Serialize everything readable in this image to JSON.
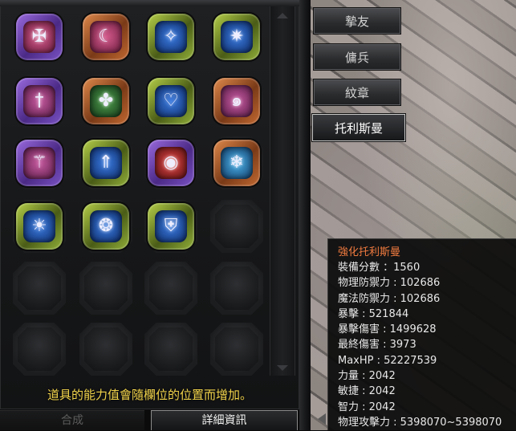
{
  "inventory": {
    "notice": "道具的能力值會隨欄位的位置而增加。",
    "rows": [
      [
        {
          "frame": "purple",
          "inner": "pink",
          "icon": "cross-shield-icon",
          "glyph": "✠"
        },
        {
          "frame": "orange",
          "inner": "pink",
          "icon": "crescent-gear-icon",
          "glyph": "☾"
        },
        {
          "frame": "green",
          "inner": "blue",
          "icon": "figure-star-icon",
          "glyph": "✧"
        },
        {
          "frame": "green",
          "inner": "blue",
          "icon": "snowflake-star-icon",
          "glyph": "✷"
        }
      ],
      [
        {
          "frame": "purple",
          "inner": "rose",
          "icon": "sword-emblem-icon",
          "glyph": "†"
        },
        {
          "frame": "orange",
          "inner": "green",
          "icon": "clover-cross-icon",
          "glyph": "✤"
        },
        {
          "frame": "green",
          "inner": "blue",
          "icon": "heart-icon",
          "glyph": "♡"
        },
        {
          "frame": "orange",
          "inner": "rose",
          "icon": "spiral-icon",
          "glyph": "๑"
        }
      ],
      [
        {
          "frame": "purple",
          "inner": "rose",
          "icon": "trident-icon",
          "glyph": "⚚"
        },
        {
          "frame": "green",
          "inner": "blue",
          "icon": "up-arrow-orbit-icon",
          "glyph": "⇑"
        },
        {
          "frame": "purple",
          "inner": "red",
          "icon": "map-pin-icon",
          "glyph": "◉"
        },
        {
          "frame": "orange",
          "inner": "cyan",
          "icon": "snowflake-icon",
          "glyph": "❄"
        }
      ],
      [
        {
          "frame": "green",
          "inner": "blue",
          "icon": "sun-bulb-icon",
          "glyph": "☀"
        },
        {
          "frame": "green",
          "inner": "blue",
          "icon": "wave-spiral-icon",
          "glyph": "❂"
        },
        {
          "frame": "green",
          "inner": "blue",
          "icon": "shield-emblem-icon",
          "glyph": "⛨"
        },
        null
      ],
      [
        null,
        null,
        null,
        null
      ],
      [
        null,
        null,
        null,
        null
      ]
    ]
  },
  "bottom_tabs": {
    "combine": "合成",
    "detail": "詳細資訊"
  },
  "side_menu": [
    {
      "label": "摯友",
      "active": false
    },
    {
      "label": "傭兵",
      "active": false
    },
    {
      "label": "紋章",
      "active": false
    },
    {
      "label": "托利斯曼",
      "active": true
    }
  ],
  "tooltip": {
    "title": "強化托利斯曼",
    "lines": [
      "裝備分數 ：1560",
      "物理防禦力 : 102686",
      "魔法防禦力 : 102686",
      "暴擊 : 521844",
      "暴擊傷害 : 1499628",
      "最終傷害 : 3973",
      "MaxHP : 52227539",
      "力量 : 2042",
      "敏捷 : 2042",
      "智力 : 2042",
      "物理攻擊力 : 5398070~5398070"
    ]
  }
}
